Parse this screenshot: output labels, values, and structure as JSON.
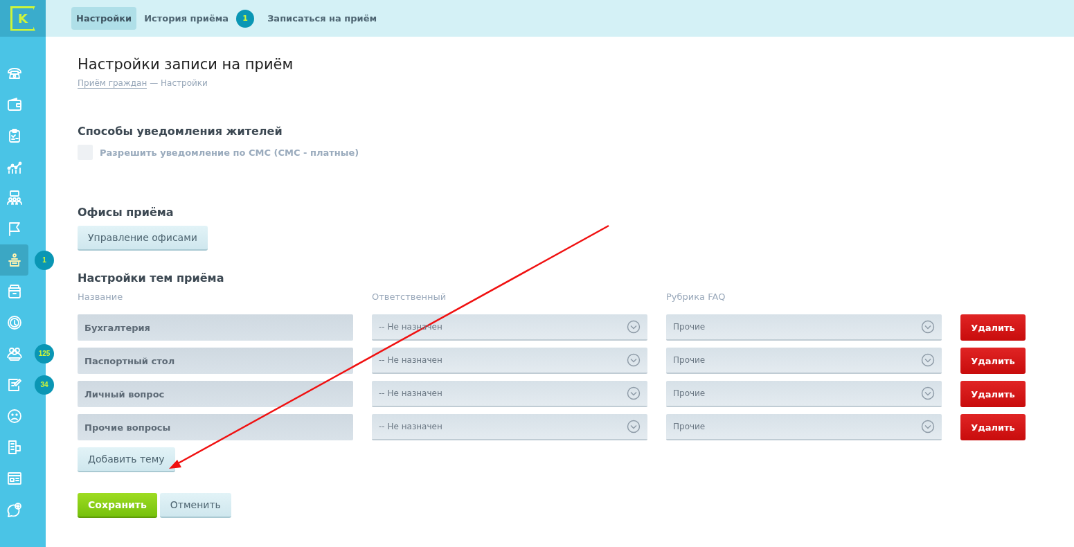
{
  "top_nav": {
    "tabs": [
      {
        "label": "Настройки",
        "selected": true
      },
      {
        "label": "История приёма",
        "selected": false,
        "badge": "1"
      },
      {
        "label": "Записаться на приём",
        "selected": false
      }
    ]
  },
  "logo": {
    "letter": "K"
  },
  "sidebar": {
    "items": [
      {
        "selected": false
      },
      {
        "selected": false
      },
      {
        "selected": false
      },
      {
        "selected": false
      },
      {
        "selected": false
      },
      {
        "selected": false
      },
      {
        "selected": true,
        "badge": "1"
      },
      {
        "selected": false
      },
      {
        "selected": false
      },
      {
        "selected": false,
        "badge": "125"
      },
      {
        "selected": false,
        "badge": "34"
      },
      {
        "selected": false
      },
      {
        "selected": false
      },
      {
        "selected": false
      },
      {
        "selected": false
      }
    ]
  },
  "page": {
    "title": "Настройки записи на приём",
    "breadcrumb": {
      "link": "Приём граждан",
      "current": "— Настройки"
    }
  },
  "notifications": {
    "heading": "Способы уведомления жителей",
    "sms_option": {
      "label": "Разрешить уведомление по СМС (СМС - платные)",
      "checked": false
    }
  },
  "offices": {
    "heading": "Офисы приёма",
    "button": "Управление офисами"
  },
  "topics": {
    "heading": "Настройки тем приёма",
    "columns": [
      "Название",
      "Ответственный",
      "Рубрика FAQ"
    ],
    "rows": [
      {
        "name": "Бухгалтерия",
        "responsible": "-- Не назначен",
        "faq": "Прочие",
        "delete": "Удалить"
      },
      {
        "name": "Паспортный стол",
        "responsible": "-- Не назначен",
        "faq": "Прочие",
        "delete": "Удалить"
      },
      {
        "name": "Личный вопрос",
        "responsible": "-- Не назначен",
        "faq": "Прочие",
        "delete": "Удалить"
      },
      {
        "name": "Прочие вопросы",
        "responsible": "-- Не назначен",
        "faq": "Прочие",
        "delete": "Удалить"
      }
    ],
    "add_button": "Добавить тему"
  },
  "actions": {
    "save": "Сохранить",
    "cancel": "Отменить"
  }
}
